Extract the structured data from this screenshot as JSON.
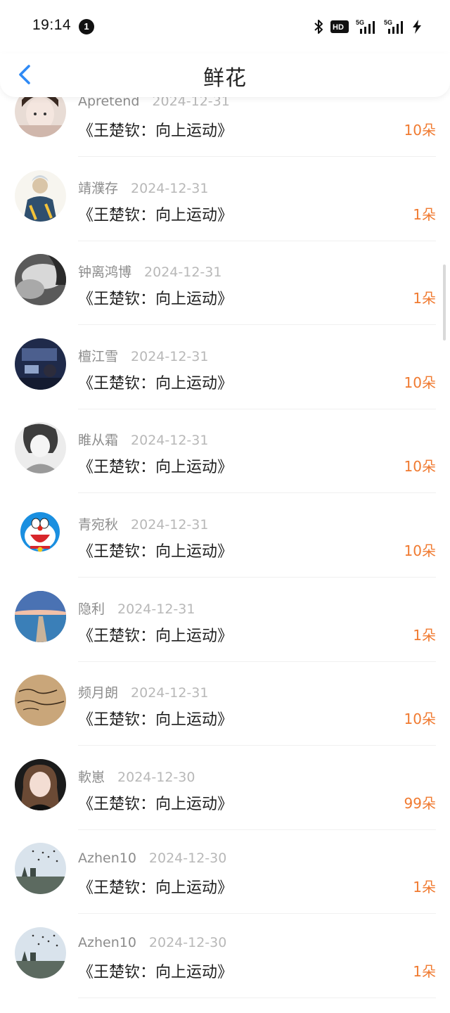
{
  "status_bar": {
    "time": "19:14",
    "notification_count": "1",
    "icons": [
      "bluetooth-icon",
      "hd-icon",
      "signal-5g-icon",
      "signal-5g-icon",
      "charging-icon"
    ],
    "hd_label": "HD",
    "net_label": "5G"
  },
  "header": {
    "title": "鲜花",
    "back_icon": "chevron-left-icon",
    "accent_color": "#2f8af5"
  },
  "colors": {
    "amount": "#f07a30",
    "nickname": "#8c8c8c",
    "date": "#b8b8b8"
  },
  "flowers": [
    {
      "nickname": "Apretend",
      "date": "2024-12-31",
      "book": "《王楚钦：向上运动》",
      "amount": "10朵"
    },
    {
      "nickname": "靖濮存",
      "date": "2024-12-31",
      "book": "《王楚钦：向上运动》",
      "amount": "1朵"
    },
    {
      "nickname": "钟离鸿博",
      "date": "2024-12-31",
      "book": "《王楚钦：向上运动》",
      "amount": "1朵"
    },
    {
      "nickname": "檀江雪",
      "date": "2024-12-31",
      "book": "《王楚钦：向上运动》",
      "amount": "10朵"
    },
    {
      "nickname": "睢从霜",
      "date": "2024-12-31",
      "book": "《王楚钦：向上运动》",
      "amount": "10朵"
    },
    {
      "nickname": "青宛秋",
      "date": "2024-12-31",
      "book": "《王楚钦：向上运动》",
      "amount": "10朵"
    },
    {
      "nickname": "隐利",
      "date": "2024-12-31",
      "book": "《王楚钦：向上运动》",
      "amount": "1朵"
    },
    {
      "nickname": "频月朗",
      "date": "2024-12-31",
      "book": "《王楚钦：向上运动》",
      "amount": "10朵"
    },
    {
      "nickname": "軟崽",
      "date": "2024-12-30",
      "book": "《王楚钦：向上运动》",
      "amount": "99朵"
    },
    {
      "nickname": "Azhen10",
      "date": "2024-12-30",
      "book": "《王楚钦：向上运动》",
      "amount": "1朵"
    },
    {
      "nickname": "Azhen10",
      "date": "2024-12-30",
      "book": "《王楚钦：向上运动》",
      "amount": "1朵"
    }
  ]
}
